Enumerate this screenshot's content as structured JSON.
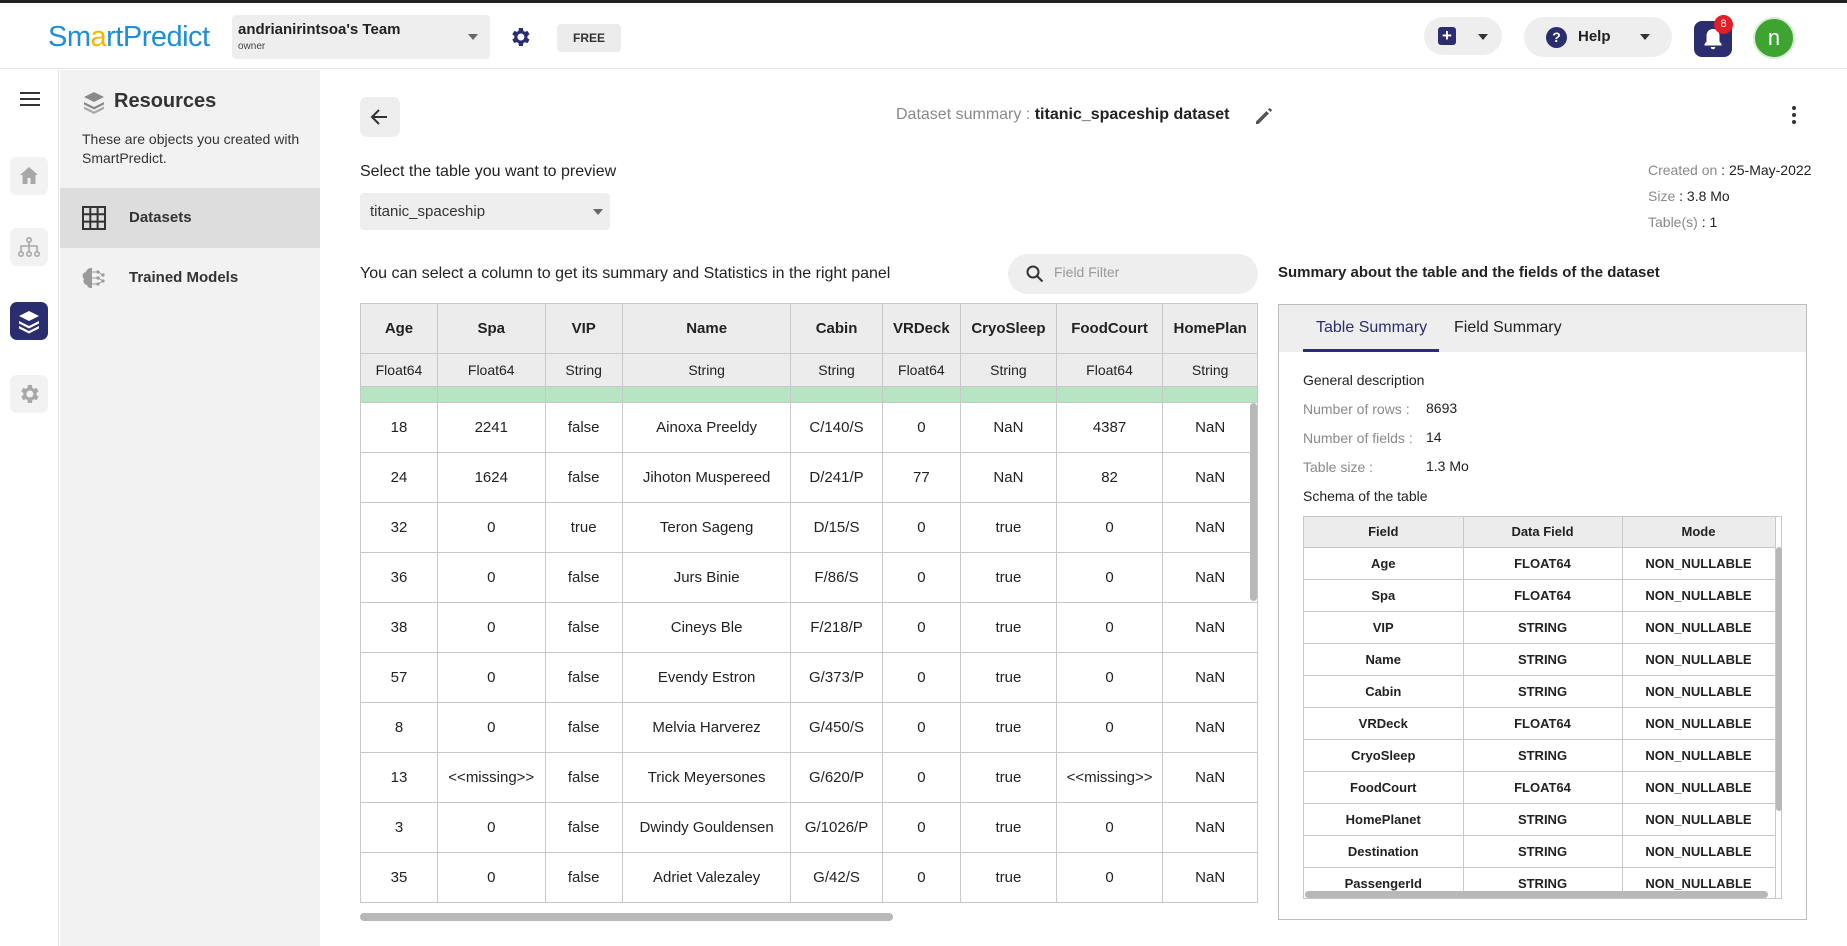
{
  "header": {
    "logo_pre": "Sm",
    "logo_dot": "a",
    "logo_post": "rtPredict",
    "team_name": "andrianirintsoa's Team",
    "team_role": "owner",
    "plan_badge": "FREE",
    "help_label": "Help",
    "notification_count": "8",
    "avatar_initial": "n"
  },
  "sidebar": {
    "title": "Resources",
    "description": "These are objects you created with SmartPredict.",
    "items": [
      {
        "label": "Datasets",
        "icon": "grid-icon",
        "active": true
      },
      {
        "label": "Trained Models",
        "icon": "brain-icon",
        "active": false
      }
    ],
    "rail_icons": [
      "menu-icon",
      "home-icon",
      "flow-icon",
      "layers-icon",
      "settings-icon"
    ]
  },
  "page": {
    "title_prefix": "Dataset summary :",
    "dataset_name": "titanic_spaceship dataset",
    "created_label": "Created on",
    "created_value": "25-May-2022",
    "size_label": "Size",
    "size_value": "3.8 Mo",
    "tables_label": "Table(s)",
    "tables_value": "1",
    "select_label": "Select the table you want to preview",
    "selected_table": "titanic_spaceship",
    "column_hint": "You can select a column to get its summary and Statistics in the right panel",
    "filter_placeholder": "Field Filter"
  },
  "preview_table": {
    "columns": [
      {
        "name": "Age",
        "type": "Float64"
      },
      {
        "name": "Spa",
        "type": "Float64"
      },
      {
        "name": "VIP",
        "type": "String"
      },
      {
        "name": "Name",
        "type": "String"
      },
      {
        "name": "Cabin",
        "type": "String"
      },
      {
        "name": "VRDeck",
        "type": "Float64"
      },
      {
        "name": "CryoSleep",
        "type": "String"
      },
      {
        "name": "FoodCourt",
        "type": "Float64"
      },
      {
        "name": "HomePlan",
        "type": "String"
      }
    ],
    "rows": [
      [
        "18",
        "2241",
        "false",
        "Ainoxa Preeldy",
        "C/140/S",
        "0",
        "NaN",
        "4387",
        "NaN"
      ],
      [
        "24",
        "1624",
        "false",
        "Jihoton Muspereed",
        "D/241/P",
        "77",
        "NaN",
        "82",
        "NaN"
      ],
      [
        "32",
        "0",
        "true",
        "Teron Sageng",
        "D/15/S",
        "0",
        "true",
        "0",
        "NaN"
      ],
      [
        "36",
        "0",
        "false",
        "Jurs Binie",
        "F/86/S",
        "0",
        "true",
        "0",
        "NaN"
      ],
      [
        "38",
        "0",
        "false",
        "Cineys Ble",
        "F/218/P",
        "0",
        "true",
        "0",
        "NaN"
      ],
      [
        "57",
        "0",
        "false",
        "Evendy Estron",
        "G/373/P",
        "0",
        "true",
        "0",
        "NaN"
      ],
      [
        "8",
        "0",
        "false",
        "Melvia Harverez",
        "G/450/S",
        "0",
        "true",
        "0",
        "NaN"
      ],
      [
        "13",
        "<<missing>>",
        "false",
        "Trick Meyersones",
        "G/620/P",
        "0",
        "true",
        "<<missing>>",
        "NaN"
      ],
      [
        "3",
        "0",
        "false",
        "Dwindy Gouldensen",
        "G/1026/P",
        "0",
        "true",
        "0",
        "NaN"
      ],
      [
        "35",
        "0",
        "false",
        "Adriet Valezaley",
        "G/42/S",
        "0",
        "true",
        "0",
        "NaN"
      ]
    ]
  },
  "summary": {
    "title": "Summary about the table and the fields of the dataset",
    "tabs": [
      "Table Summary",
      "Field Summary"
    ],
    "general_description": "General description",
    "rows_label": "Number of rows :",
    "rows_value": "8693",
    "fields_label": "Number of fields :",
    "fields_value": "14",
    "size_label": "Table size :",
    "size_value": "1.3 Mo",
    "schema_label": "Schema of the table",
    "schema_headers": [
      "Field",
      "Data Field",
      "Mode"
    ],
    "schema_rows": [
      [
        "Age",
        "FLOAT64",
        "NON_NULLABLE"
      ],
      [
        "Spa",
        "FLOAT64",
        "NON_NULLABLE"
      ],
      [
        "VIP",
        "STRING",
        "NON_NULLABLE"
      ],
      [
        "Name",
        "STRING",
        "NON_NULLABLE"
      ],
      [
        "Cabin",
        "STRING",
        "NON_NULLABLE"
      ],
      [
        "VRDeck",
        "FLOAT64",
        "NON_NULLABLE"
      ],
      [
        "CryoSleep",
        "STRING",
        "NON_NULLABLE"
      ],
      [
        "FoodCourt",
        "FLOAT64",
        "NON_NULLABLE"
      ],
      [
        "HomePlanet",
        "STRING",
        "NON_NULLABLE"
      ],
      [
        "Destination",
        "STRING",
        "NON_NULLABLE"
      ],
      [
        "PassengerId",
        "STRING",
        "NON_NULLABLE"
      ]
    ]
  },
  "colors": {
    "brand": "#2a2d6e",
    "avatar": "#3da331",
    "notification": "#e41e26",
    "quality_bar": "#b7e4c3"
  }
}
